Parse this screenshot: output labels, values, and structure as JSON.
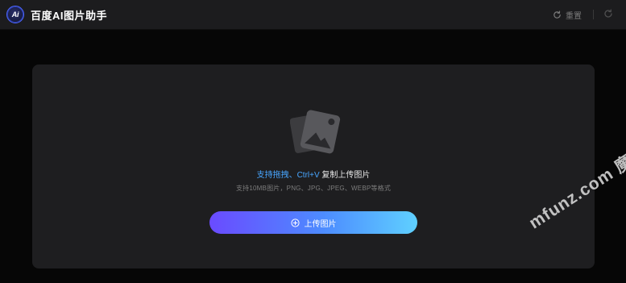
{
  "header": {
    "logo_text": "Ai",
    "title": "百度AI图片助手",
    "reset_label": "重置",
    "reset_icon": "refresh-icon",
    "redo_icon": "redo-icon"
  },
  "upload": {
    "placeholder_icon": "image-placeholder-icon",
    "hint_accent": "支持拖拽、Ctrl+V",
    "hint_rest": " 复制上传图片",
    "formats": "支持10MB图片，PNG、JPG、JPEG、WEBP等格式",
    "button_icon": "plus-circle-icon",
    "button_label": "上传图片"
  },
  "watermark": "mfunz.com 魔趣网",
  "colors": {
    "accent": "#48a6ff",
    "button_gradient_start": "#6a4bff",
    "button_gradient_end": "#5fd0ff",
    "header_bg": "#1c1c1e",
    "panel_bg": "#1e1e20"
  }
}
